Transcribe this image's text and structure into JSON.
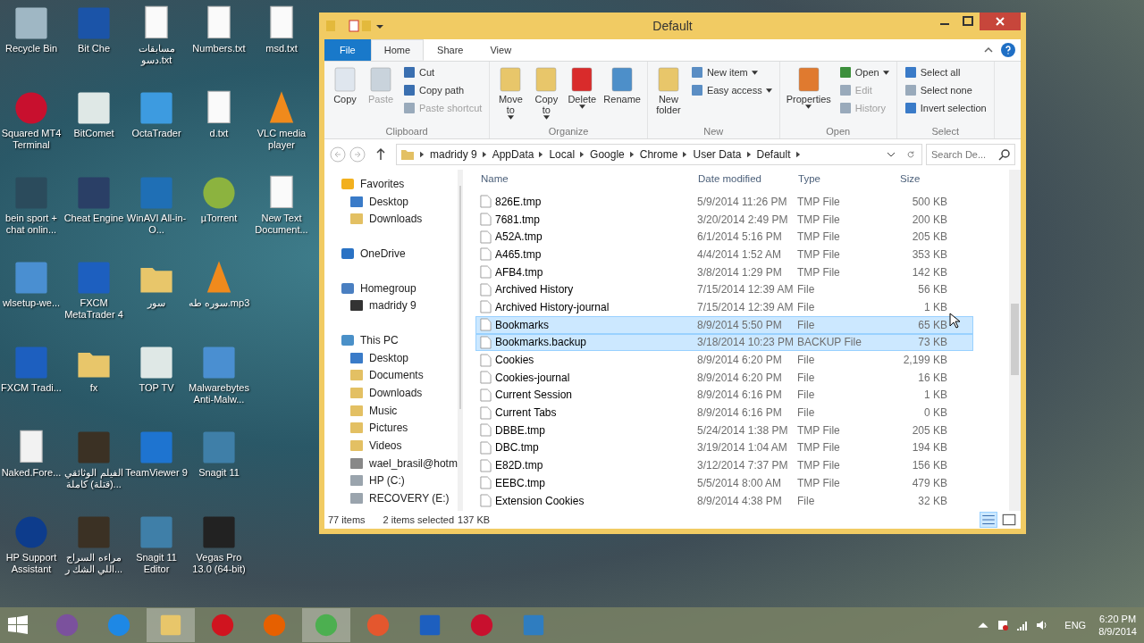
{
  "desktop_icons": [
    {
      "label": "Recycle Bin",
      "kind": "bin"
    },
    {
      "label": "Squared MT4 Terminal",
      "kind": "ring"
    },
    {
      "label": "bein sport + chat onlin...",
      "kind": "blank"
    },
    {
      "label": "wlsetup-we...",
      "kind": "setup"
    },
    {
      "label": "FXCM Tradi...",
      "kind": "fx"
    },
    {
      "label": "Naked.Fore...",
      "kind": "doc"
    },
    {
      "label": "HP Support Assistant",
      "kind": "help"
    },
    {
      "label": "Bit Che",
      "kind": "bc"
    },
    {
      "label": "BitComet",
      "kind": "window"
    },
    {
      "label": "Cheat Engine",
      "kind": "gear"
    },
    {
      "label": "FXCM MetaTrader 4",
      "kind": "fx"
    },
    {
      "label": "fx",
      "kind": "folder"
    },
    {
      "label": "الفيلم الوثائقي (قتلة) كاملة...",
      "kind": "video"
    },
    {
      "label": "مراءه السراج اللي الشك ر...",
      "kind": "video"
    },
    {
      "label": "مسابقات دسو.txt",
      "kind": "text"
    },
    {
      "label": "OctaTrader",
      "kind": "octa"
    },
    {
      "label": "WinAVI All-in-O...",
      "kind": "disc"
    },
    {
      "label": "سور",
      "kind": "folder"
    },
    {
      "label": "TOP TV",
      "kind": "window"
    },
    {
      "label": "TeamViewer 9",
      "kind": "teamviewer"
    },
    {
      "label": "Snagit 11 Editor",
      "kind": "snagit"
    },
    {
      "label": "Numbers.txt",
      "kind": "text"
    },
    {
      "label": "d.txt",
      "kind": "text"
    },
    {
      "label": "µTorrent",
      "kind": "torrent"
    },
    {
      "label": "سوره طه.mp3",
      "kind": "cone"
    },
    {
      "label": "Malwarebytes Anti-Malw...",
      "kind": "setup"
    },
    {
      "label": "Snagit 11",
      "kind": "snagit"
    },
    {
      "label": "Vegas Pro 13.0 (64-bit)",
      "kind": "film"
    },
    {
      "label": "msd.txt",
      "kind": "text"
    },
    {
      "label": "VLC media player",
      "kind": "cone"
    },
    {
      "label": "New Text Document...",
      "kind": "text"
    }
  ],
  "window": {
    "title": "Default"
  },
  "ribbon_tabs": [
    {
      "label": "File",
      "kind": "file",
      "selected": false
    },
    {
      "label": "Home",
      "kind": "tab",
      "selected": true
    },
    {
      "label": "Share",
      "kind": "tab",
      "selected": false
    },
    {
      "label": "View",
      "kind": "tab",
      "selected": false
    }
  ],
  "ribbon_groups": [
    {
      "label": "Clipboard",
      "commands": [
        {
          "label": "Copy",
          "kind": "large",
          "disabled": false,
          "dropdown": false
        },
        {
          "label": "Paste",
          "kind": "large",
          "disabled": true,
          "dropdown": false
        },
        {
          "kind": "stack",
          "items": [
            {
              "label": "Cut",
              "disabled": false,
              "dropdown": false
            },
            {
              "label": "Copy path",
              "disabled": false,
              "dropdown": false
            },
            {
              "label": "Paste shortcut",
              "disabled": true,
              "dropdown": false
            }
          ]
        }
      ]
    },
    {
      "label": "Organize",
      "commands": [
        {
          "label": "Move to",
          "kind": "large",
          "disabled": false,
          "dropdown": true
        },
        {
          "label": "Copy to",
          "kind": "large",
          "disabled": false,
          "dropdown": true
        },
        {
          "label": "Delete",
          "kind": "large",
          "disabled": false,
          "dropdown": true
        },
        {
          "label": "Rename",
          "kind": "large",
          "disabled": false,
          "dropdown": false
        }
      ]
    },
    {
      "label": "New",
      "commands": [
        {
          "label": "New folder",
          "kind": "large",
          "disabled": false,
          "dropdown": false
        },
        {
          "kind": "stack",
          "items": [
            {
              "label": "New item",
              "disabled": false,
              "dropdown": true
            },
            {
              "label": "Easy access",
              "disabled": false,
              "dropdown": true
            }
          ]
        }
      ]
    },
    {
      "label": "Open",
      "commands": [
        {
          "label": "Properties",
          "kind": "large",
          "disabled": false,
          "dropdown": true
        },
        {
          "kind": "stack",
          "items": [
            {
              "label": "Open",
              "disabled": false,
              "dropdown": true
            },
            {
              "label": "Edit",
              "disabled": true,
              "dropdown": false
            },
            {
              "label": "History",
              "disabled": true,
              "dropdown": false
            }
          ]
        }
      ]
    },
    {
      "label": "Select",
      "commands": [
        {
          "kind": "stack",
          "items": [
            {
              "label": "Select all",
              "disabled": false,
              "dropdown": false
            },
            {
              "label": "Select none",
              "disabled": false,
              "dropdown": false
            },
            {
              "label": "Invert selection",
              "disabled": false,
              "dropdown": false
            }
          ]
        }
      ]
    }
  ],
  "address": {
    "crumbs": [
      "madridy 9",
      "AppData",
      "Local",
      "Google",
      "Chrome",
      "User Data",
      "Default"
    ],
    "search_placeholder": "Search De..."
  },
  "navigation": [
    {
      "label": "Favorites",
      "kind": "star",
      "children": [
        {
          "label": "Desktop",
          "kind": "desktop"
        },
        {
          "label": "Downloads",
          "kind": "download"
        }
      ]
    },
    {
      "label": "OneDrive",
      "kind": "cloud"
    },
    {
      "label": "Homegroup",
      "kind": "group",
      "children": [
        {
          "label": "madridy 9",
          "kind": "user"
        }
      ]
    },
    {
      "label": "This PC",
      "kind": "pc",
      "children": [
        {
          "label": "Desktop",
          "kind": "desktop"
        },
        {
          "label": "Documents",
          "kind": "folder"
        },
        {
          "label": "Downloads",
          "kind": "download"
        },
        {
          "label": "Music",
          "kind": "folder"
        },
        {
          "label": "Pictures",
          "kind": "folder"
        },
        {
          "label": "Videos",
          "kind": "folder"
        },
        {
          "label": "wael_brasil@hotm",
          "kind": "phone"
        },
        {
          "label": "HP (C:)",
          "kind": "drive"
        },
        {
          "label": "RECOVERY (E:)",
          "kind": "drive"
        }
      ]
    }
  ],
  "table": {
    "columns": [
      "Name",
      "Date modified",
      "Type",
      "Size"
    ],
    "rows": [
      {
        "name": "826E.tmp",
        "date": "5/9/2014 11:26 PM",
        "type": "TMP File",
        "size": "500 KB",
        "selected": false
      },
      {
        "name": "7681.tmp",
        "date": "3/20/2014 2:49 PM",
        "type": "TMP File",
        "size": "200 KB",
        "selected": false
      },
      {
        "name": "A52A.tmp",
        "date": "6/1/2014 5:16 PM",
        "type": "TMP File",
        "size": "205 KB",
        "selected": false
      },
      {
        "name": "A465.tmp",
        "date": "4/4/2014 1:52 AM",
        "type": "TMP File",
        "size": "353 KB",
        "selected": false
      },
      {
        "name": "AFB4.tmp",
        "date": "3/8/2014 1:29 PM",
        "type": "TMP File",
        "size": "142 KB",
        "selected": false
      },
      {
        "name": "Archived History",
        "date": "7/15/2014 12:39 AM",
        "type": "File",
        "size": "56 KB",
        "selected": false
      },
      {
        "name": "Archived History-journal",
        "date": "7/15/2014 12:39 AM",
        "type": "File",
        "size": "1 KB",
        "selected": false
      },
      {
        "name": "Bookmarks",
        "date": "8/9/2014 5:50 PM",
        "type": "File",
        "size": "65 KB",
        "selected": true
      },
      {
        "name": "Bookmarks.backup",
        "date": "3/18/2014 10:23 PM",
        "type": "BACKUP File",
        "size": "73 KB",
        "selected": true
      },
      {
        "name": "Cookies",
        "date": "8/9/2014 6:20 PM",
        "type": "File",
        "size": "2,199 KB",
        "selected": false
      },
      {
        "name": "Cookies-journal",
        "date": "8/9/2014 6:20 PM",
        "type": "File",
        "size": "16 KB",
        "selected": false
      },
      {
        "name": "Current Session",
        "date": "8/9/2014 6:16 PM",
        "type": "File",
        "size": "1 KB",
        "selected": false
      },
      {
        "name": "Current Tabs",
        "date": "8/9/2014 6:16 PM",
        "type": "File",
        "size": "0 KB",
        "selected": false
      },
      {
        "name": "DBBE.tmp",
        "date": "5/24/2014 1:38 PM",
        "type": "TMP File",
        "size": "205 KB",
        "selected": false
      },
      {
        "name": "DBC.tmp",
        "date": "3/19/2014 1:04 AM",
        "type": "TMP File",
        "size": "194 KB",
        "selected": false
      },
      {
        "name": "E82D.tmp",
        "date": "3/12/2014 7:37 PM",
        "type": "TMP File",
        "size": "156 KB",
        "selected": false
      },
      {
        "name": "EEBC.tmp",
        "date": "5/5/2014 8:00 AM",
        "type": "TMP File",
        "size": "479 KB",
        "selected": false
      },
      {
        "name": "Extension Cookies",
        "date": "8/9/2014 4:38 PM",
        "type": "File",
        "size": "32 KB",
        "selected": false
      }
    ]
  },
  "status_bar": {
    "count": "77 items",
    "selection": "2 items selected",
    "selection_size": "137 KB"
  },
  "taskbar": {
    "apps": [
      {
        "kind": "viber",
        "selected": false
      },
      {
        "kind": "ie",
        "selected": false
      },
      {
        "kind": "explorer",
        "selected": true
      },
      {
        "kind": "opera",
        "selected": false
      },
      {
        "kind": "firefox",
        "selected": false
      },
      {
        "kind": "chrome",
        "selected": true
      },
      {
        "kind": "flame",
        "selected": false
      },
      {
        "kind": "fxcm",
        "selected": false
      },
      {
        "kind": "ring",
        "selected": false
      },
      {
        "kind": "fxcm2",
        "selected": false
      }
    ],
    "language": "ENG",
    "time": "6:20 PM",
    "date": "8/9/2014"
  }
}
